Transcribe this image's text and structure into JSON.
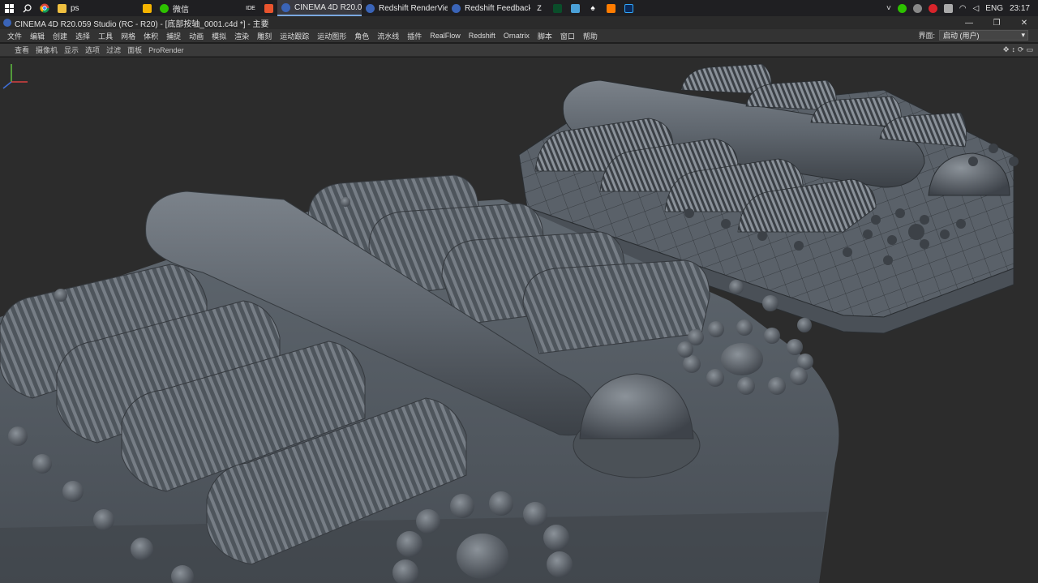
{
  "taskbar": {
    "tasks": [
      {
        "label": "ps",
        "active": false
      },
      {
        "label": "微信",
        "active": false
      },
      {
        "label": "CINEMA 4D R20.05...",
        "active": true
      },
      {
        "label": "Redshift RenderView",
        "active": false
      },
      {
        "label": "Redshift Feedback ...",
        "active": false
      }
    ],
    "language": "ENG",
    "clock": "23:17"
  },
  "window": {
    "title": "CINEMA 4D R20.059 Studio (RC - R20) - [底部按轴_0001.c4d *] - 主要"
  },
  "menu": {
    "items": [
      "文件",
      "编辑",
      "创建",
      "选择",
      "工具",
      "网格",
      "体积",
      "捕捉",
      "动画",
      "模拟",
      "渲染",
      "雕刻",
      "运动跟踪",
      "运动图形",
      "角色",
      "流水线",
      "插件",
      "RealFlow",
      "Redshift",
      "Ornatrix",
      "脚本",
      "窗口",
      "帮助"
    ],
    "layout_label": "界面:",
    "layout_value": "启动 (用户)"
  },
  "viewport_menu": {
    "items": [
      "查看",
      "摄像机",
      "显示",
      "选项",
      "过滤",
      "面板",
      "ProRender"
    ]
  },
  "colors": {
    "accent": "#7aa8e0",
    "taskbar_bg": "#1f1f22",
    "viewport_bg": "#2c2c2c",
    "model_shade": "#5b626a"
  }
}
